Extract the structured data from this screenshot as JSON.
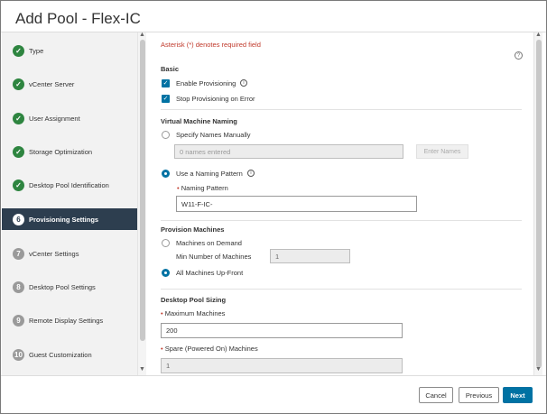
{
  "dialog": {
    "title": "Add Pool - Flex-IC"
  },
  "steps": [
    {
      "label": "Type",
      "number": "1",
      "state": "done"
    },
    {
      "label": "vCenter Server",
      "number": "2",
      "state": "done"
    },
    {
      "label": "User Assignment",
      "number": "3",
      "state": "done"
    },
    {
      "label": "Storage Optimization",
      "number": "4",
      "state": "done"
    },
    {
      "label": "Desktop Pool Identification",
      "number": "5",
      "state": "done"
    },
    {
      "label": "Provisioning Settings",
      "number": "6",
      "state": "active"
    },
    {
      "label": "vCenter Settings",
      "number": "7",
      "state": "pending"
    },
    {
      "label": "Desktop Pool Settings",
      "number": "8",
      "state": "pending"
    },
    {
      "label": "Remote Display Settings",
      "number": "9",
      "state": "pending"
    },
    {
      "label": "Guest Customization",
      "number": "10",
      "state": "pending"
    }
  ],
  "form": {
    "required_note": "Asterisk (*) denotes required field",
    "basic": {
      "heading": "Basic",
      "enable_provisioning": "Enable Provisioning",
      "stop_on_error": "Stop Provisioning on Error"
    },
    "naming": {
      "heading": "Virtual Machine Naming",
      "manual_label": "Specify Names Manually",
      "names_placeholder": "0 names entered",
      "enter_names_button": "Enter Names",
      "pattern_option": "Use a Naming Pattern",
      "pattern_field_label": "Naming Pattern",
      "pattern_value": "W11-F-IC-"
    },
    "provision": {
      "heading": "Provision Machines",
      "on_demand": "Machines on Demand",
      "min_label": "Min Number of Machines",
      "min_value": "1",
      "up_front": "All Machines Up-Front"
    },
    "sizing": {
      "heading": "Desktop Pool Sizing",
      "max_label": "Maximum Machines",
      "max_value": "200",
      "spare_label": "Spare (Powered On) Machines",
      "spare_value": "1"
    }
  },
  "footer": {
    "cancel": "Cancel",
    "previous": "Previous",
    "next": "Next"
  },
  "colors": {
    "accent": "#0072a3",
    "done": "#2e8540",
    "active_step_bg": "#2d3e4f",
    "required": "#c0392b"
  },
  "icons": {
    "done": "check-icon",
    "help": "help-circle-icon",
    "info": "info-icon"
  }
}
